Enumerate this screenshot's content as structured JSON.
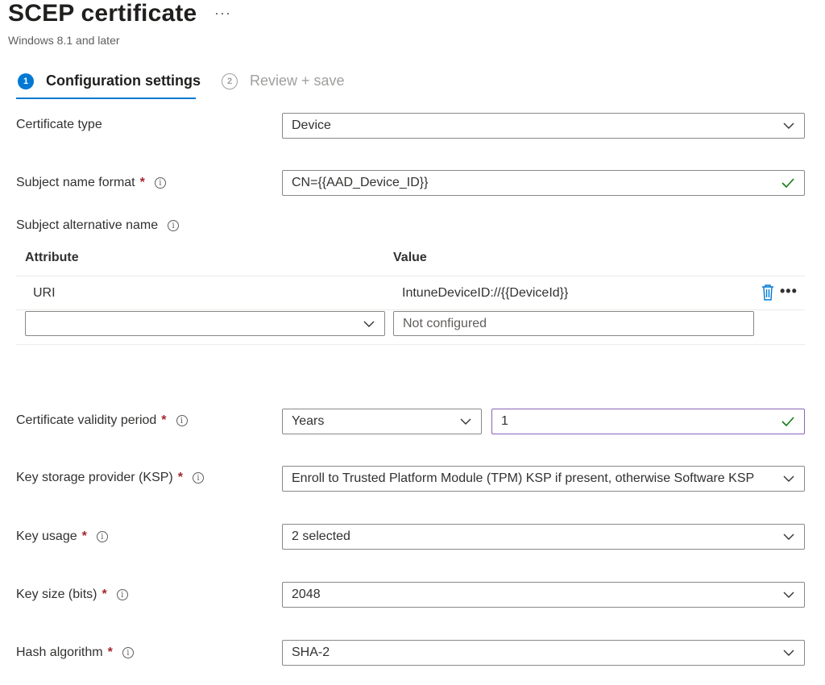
{
  "header": {
    "title": "SCEP certificate",
    "more_label": "···",
    "subtitle": "Windows 8.1 and later"
  },
  "wizard": {
    "steps": [
      {
        "number": "1",
        "label": "Configuration settings",
        "active": true
      },
      {
        "number": "2",
        "label": "Review + save",
        "active": false
      }
    ]
  },
  "form": {
    "certificate_type": {
      "label": "Certificate type",
      "value": "Device"
    },
    "subject_name_format": {
      "label": "Subject name format",
      "value": "CN={{AAD_Device_ID}}"
    },
    "subject_alternative_name": {
      "label": "Subject alternative name",
      "columns": [
        "Attribute",
        "Value"
      ],
      "rows": [
        {
          "attribute": "URI",
          "value": "IntuneDeviceID://{{DeviceId}}"
        }
      ],
      "new_row": {
        "attribute_value": "",
        "value_placeholder": "Not configured"
      },
      "row_more_label": "•••"
    },
    "validity_period": {
      "label": "Certificate validity period",
      "unit": "Years",
      "value": "1"
    },
    "ksp": {
      "label": "Key storage provider (KSP)",
      "value": "Enroll to Trusted Platform Module (TPM) KSP if present, otherwise Software KSP"
    },
    "key_usage": {
      "label": "Key usage",
      "value": "2 selected"
    },
    "key_size": {
      "label": "Key size (bits)",
      "value": "2048"
    },
    "hash_algorithm": {
      "label": "Hash algorithm",
      "value": "SHA-2"
    }
  },
  "symbols": {
    "required": "*",
    "info": "i"
  },
  "colors": {
    "accent": "#0078d4",
    "required": "#a4262c",
    "success": "#107c10",
    "focus_border": "#8764b8"
  }
}
